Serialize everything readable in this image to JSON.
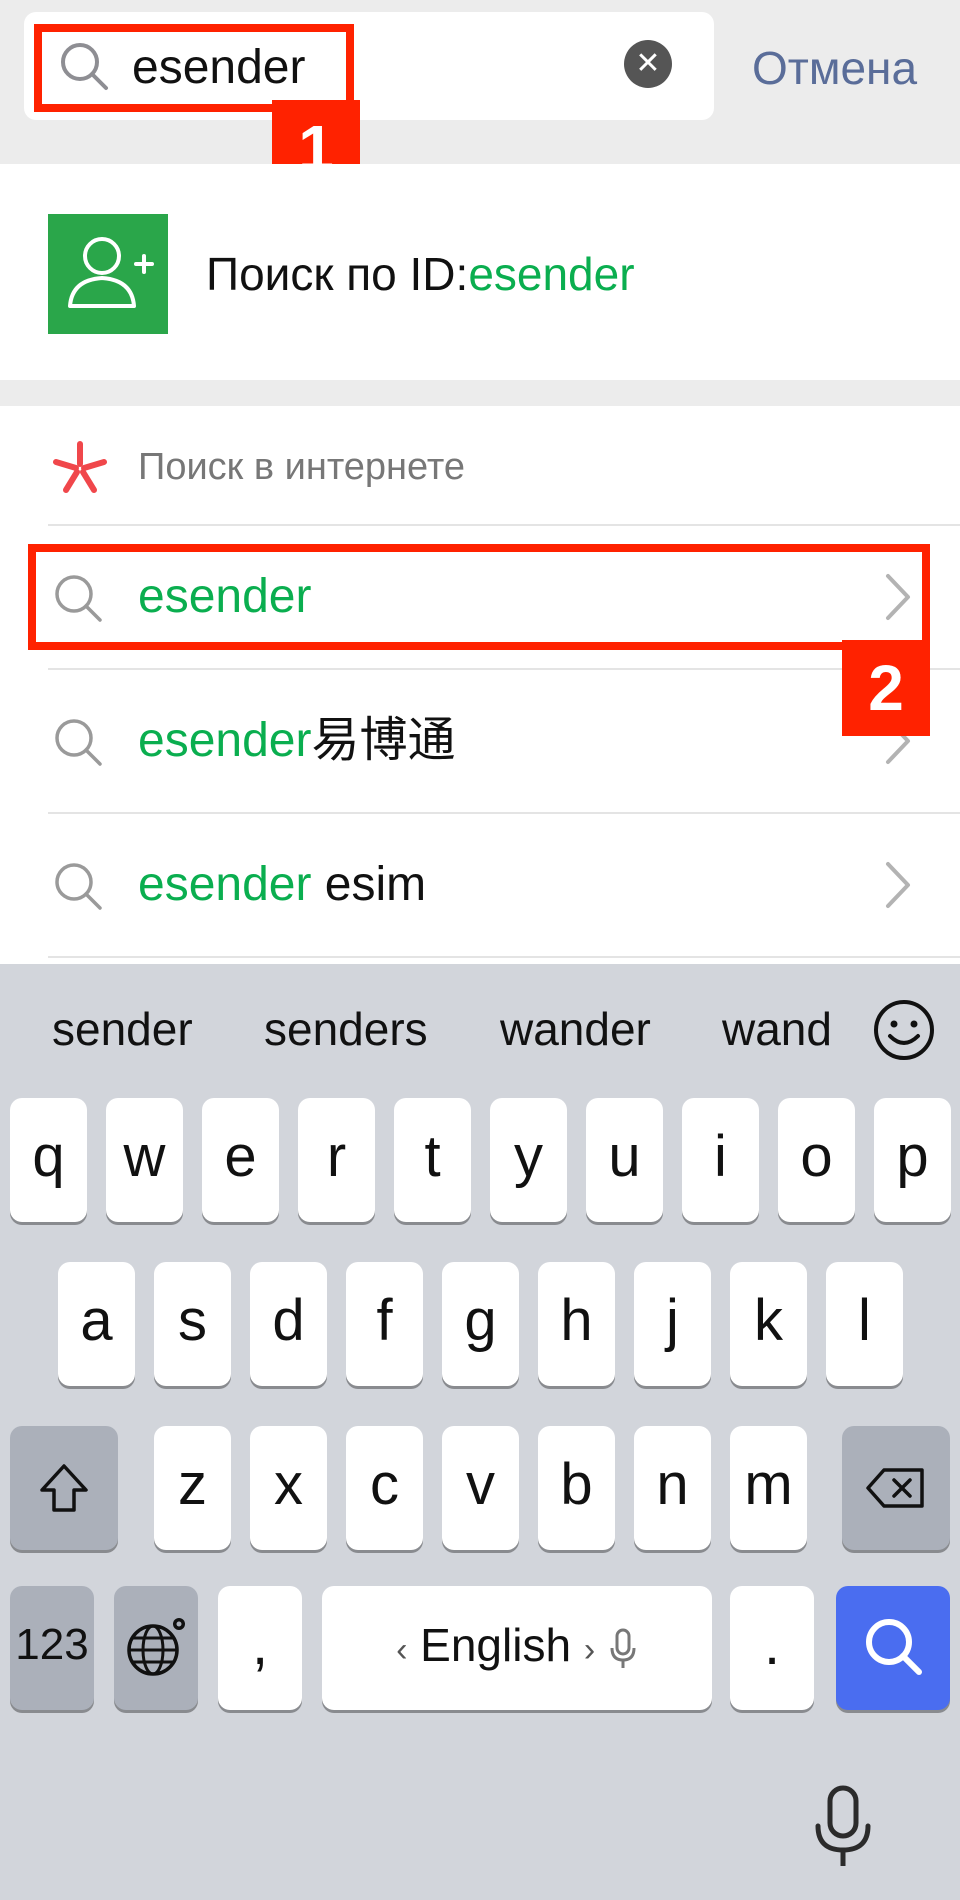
{
  "search": {
    "value": "esender",
    "cancel_label": "Отмена"
  },
  "annotations": {
    "step1_label": "1",
    "step2_label": "2",
    "color": "#ff2200"
  },
  "id_search": {
    "prefix": "Поиск по ID:",
    "term": "esender"
  },
  "web_search": {
    "title": "Поиск в интернете",
    "results": [
      {
        "highlight": "esender",
        "rest": ""
      },
      {
        "highlight": "esender",
        "rest": "易博通"
      },
      {
        "highlight": "esender",
        "rest": " esim"
      }
    ]
  },
  "keyboard": {
    "suggestions": [
      "sender",
      "senders",
      "wander",
      "wand"
    ],
    "row1": [
      "q",
      "w",
      "e",
      "r",
      "t",
      "y",
      "u",
      "i",
      "o",
      "p"
    ],
    "row2": [
      "a",
      "s",
      "d",
      "f",
      "g",
      "h",
      "j",
      "k",
      "l"
    ],
    "row3": [
      "z",
      "x",
      "c",
      "v",
      "b",
      "n",
      "m"
    ],
    "numbers_label": "123",
    "comma_label": ",",
    "space_label": "English",
    "period_label": ".",
    "accent_color": "#4a6df0"
  },
  "colors": {
    "highlight_green": "#0aae4f",
    "cancel_blue": "#5a6d99",
    "tile_green": "#2aa64a"
  }
}
